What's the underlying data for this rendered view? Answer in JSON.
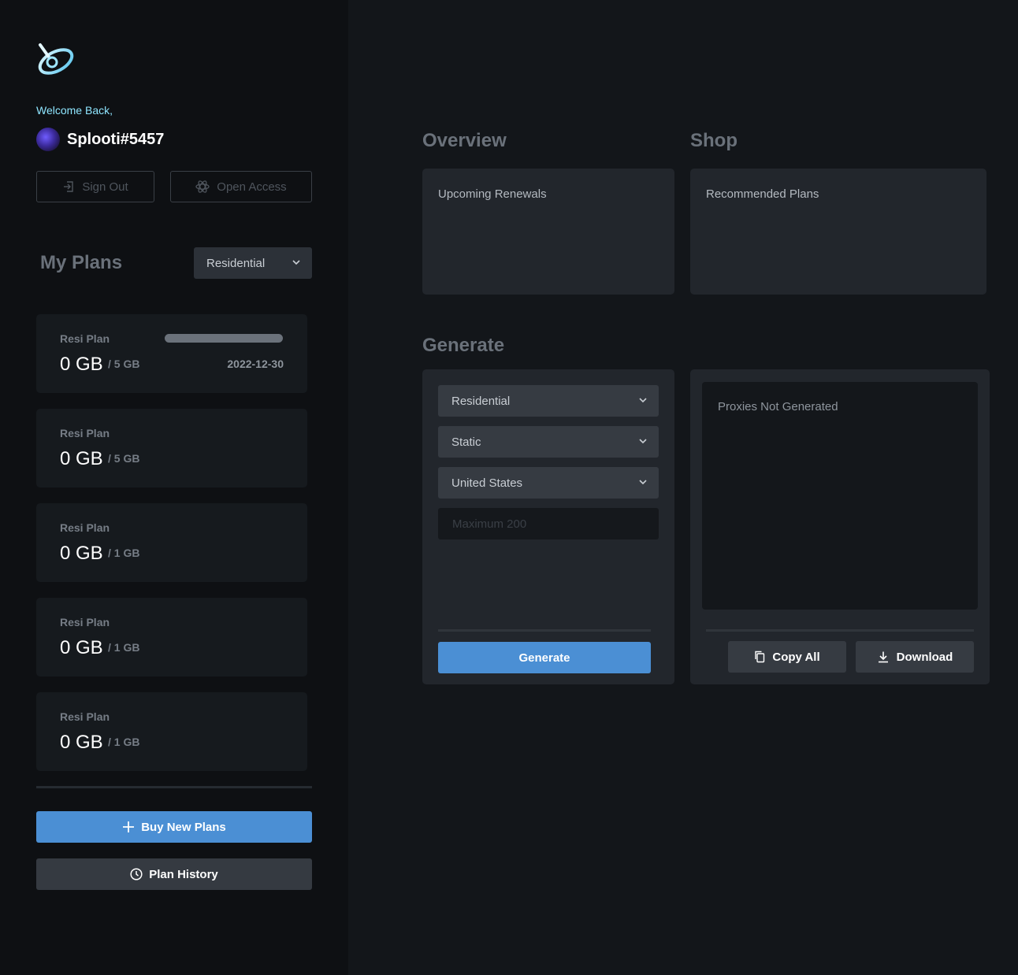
{
  "sidebar": {
    "welcome": "Welcome Back,",
    "username": "Splooti#5457",
    "sign_out_label": "Sign Out",
    "open_access_label": "Open Access",
    "my_plans_title": "My Plans",
    "plan_filter": "Residential",
    "plans": [
      {
        "name": "Resi Plan",
        "used": "0 GB",
        "total": "/ 5 GB",
        "expires": "2022-12-30",
        "usage_fraction": 0
      },
      {
        "name": "Resi Plan",
        "used": "0 GB",
        "total": "/ 5 GB"
      },
      {
        "name": "Resi Plan",
        "used": "0 GB",
        "total": "/ 1 GB"
      },
      {
        "name": "Resi Plan",
        "used": "0 GB",
        "total": "/ 1 GB"
      },
      {
        "name": "Resi Plan",
        "used": "0 GB",
        "total": "/ 1 GB"
      }
    ],
    "buy_label": "Buy New Plans",
    "history_label": "Plan History"
  },
  "overview": {
    "title": "Overview",
    "renewals_label": "Upcoming Renewals"
  },
  "shop": {
    "title": "Shop",
    "recommended_label": "Recommended Plans"
  },
  "generate": {
    "title": "Generate",
    "type_select": "Residential",
    "mode_select": "Static",
    "country_select": "United States",
    "quantity_placeholder": "Maximum 200",
    "generate_label": "Generate",
    "output_text": "Proxies Not Generated",
    "copy_label": "Copy All",
    "download_label": "Download"
  },
  "colors": {
    "accent": "#4b8fd4",
    "welcome": "#8fe6ff",
    "background": "#13161a",
    "sidebar": "#0e1013",
    "panel": "#22262c"
  }
}
